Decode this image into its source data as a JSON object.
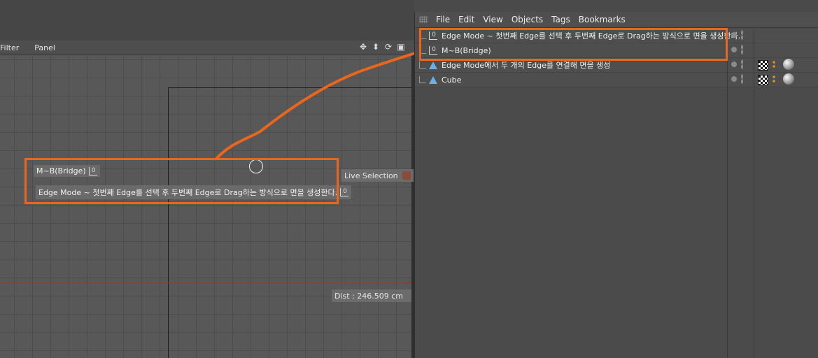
{
  "viewport": {
    "menu": [
      "Filter",
      "Panel"
    ],
    "nav_icons": [
      "move-icon",
      "zoom-icon",
      "rotate-icon",
      "layout-icon"
    ],
    "labels": {
      "bridge": "M~B(Bridge)",
      "edge_mode": "Edge Mode ~ 첫번째 Edge를 선택 후 두번째 Edge로 Drag하는 방식으로 면을 생성한다."
    },
    "tool_name": "Live Selection",
    "dist_readout": "Dist : 246.509 cm",
    "tag_glyph": "0"
  },
  "object_manager": {
    "menu": [
      "File",
      "Edit",
      "View",
      "Objects",
      "Tags",
      "Bookmarks"
    ],
    "rows": [
      {
        "name": "Edge Mode ~ 첫번째 Edge를 선택 후 두번째 Edge로 Drag하는 방식으로 면을 생성한다.",
        "icon": "null-tag-icon",
        "materials": false
      },
      {
        "name": "M~B(Bridge)",
        "icon": "null-tag-icon",
        "materials": false
      },
      {
        "name": "Edge Mode에서 두 개의 Edge를 연결해 면을 생성",
        "icon": "polygon-object-icon",
        "materials": true
      },
      {
        "name": "Cube",
        "icon": "polygon-object-icon",
        "materials": true
      }
    ]
  },
  "colors": {
    "highlight": "#e8661d",
    "background": "#4a4a4a",
    "axis_x": "#8a3f2b",
    "object_icon": "#6ab0e6"
  }
}
